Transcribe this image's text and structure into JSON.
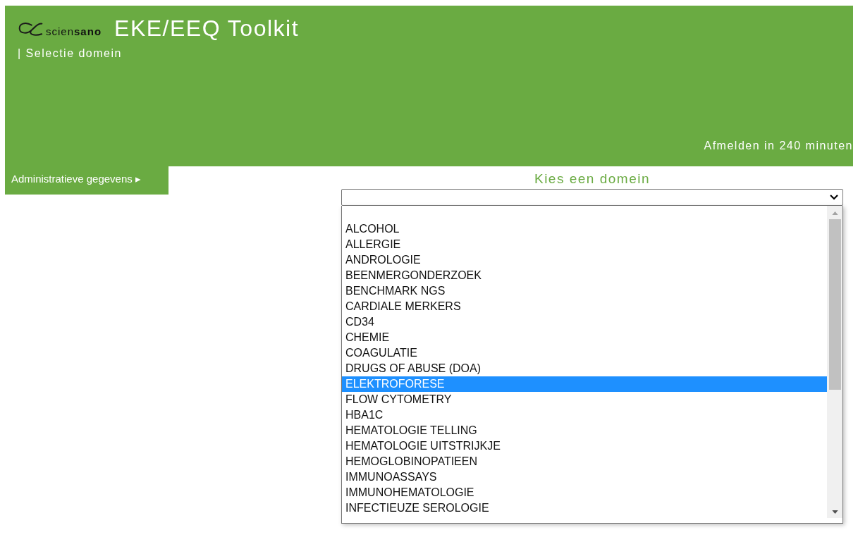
{
  "header": {
    "logo_text": "scien**sano**",
    "title": "EKE/EEQ Toolkit",
    "subtitle": "| Selectie domein",
    "session": "Afmelden in 240 minuten"
  },
  "nav": {
    "label": "Administratieve gegevens",
    "arrow": "▸"
  },
  "domain": {
    "heading": "Kies een domein",
    "options": [
      {
        "label": "ALCOHOL",
        "selected": false
      },
      {
        "label": "ALLERGIE",
        "selected": false
      },
      {
        "label": "ANDROLOGIE",
        "selected": false
      },
      {
        "label": "BEENMERGONDERZOEK",
        "selected": false
      },
      {
        "label": "BENCHMARK NGS",
        "selected": false
      },
      {
        "label": "CARDIALE MERKERS",
        "selected": false
      },
      {
        "label": "CD34",
        "selected": false
      },
      {
        "label": "CHEMIE",
        "selected": false
      },
      {
        "label": "COAGULATIE",
        "selected": false
      },
      {
        "label": "DRUGS OF ABUSE (DOA)",
        "selected": false
      },
      {
        "label": "ELEKTROFORESE",
        "selected": true
      },
      {
        "label": "FLOW CYTOMETRY",
        "selected": false
      },
      {
        "label": "HBA1C",
        "selected": false
      },
      {
        "label": "HEMATOLOGIE TELLING",
        "selected": false
      },
      {
        "label": "HEMATOLOGIE UITSTRIJKJE",
        "selected": false
      },
      {
        "label": "HEMOGLOBINOPATIEEN",
        "selected": false
      },
      {
        "label": "IMMUNOASSAYS",
        "selected": false
      },
      {
        "label": "IMMUNOHEMATOLOGIE",
        "selected": false
      },
      {
        "label": "INFECTIEUZE SEROLOGIE",
        "selected": false
      }
    ]
  }
}
